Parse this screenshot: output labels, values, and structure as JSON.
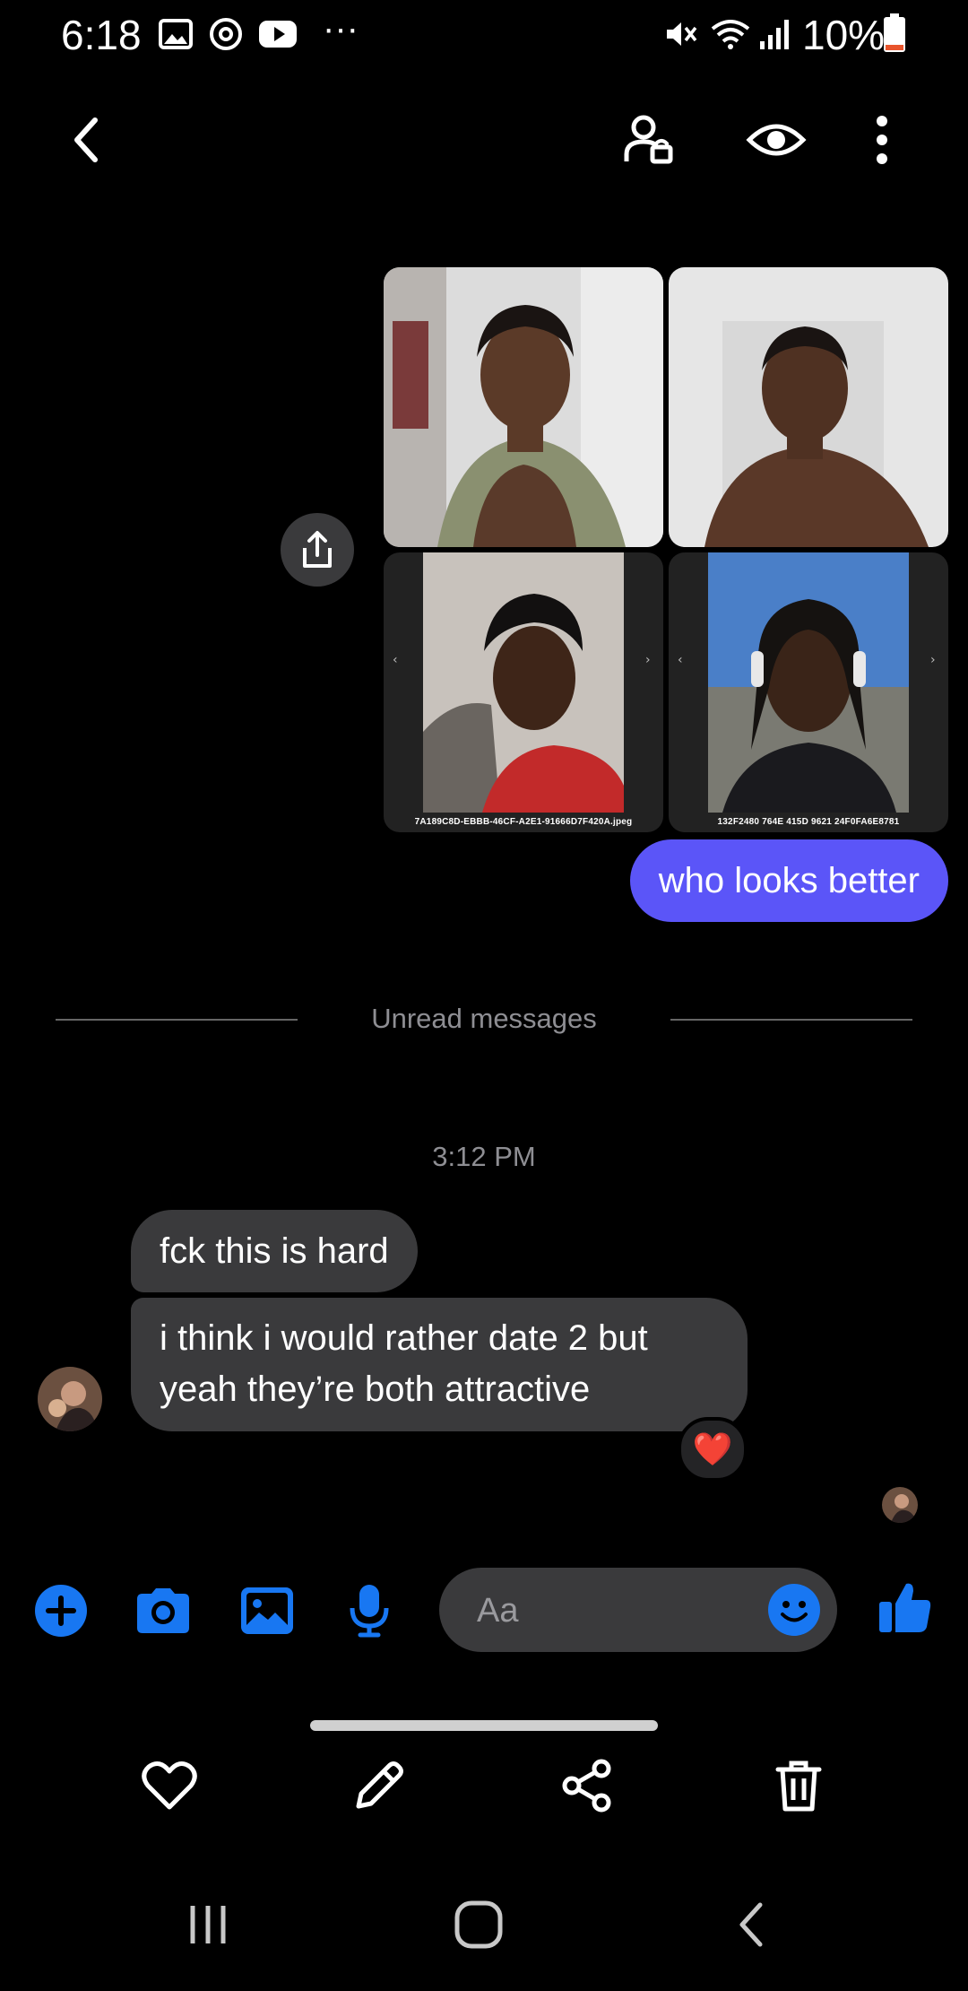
{
  "status_bar": {
    "time": "6:18",
    "battery": "10%",
    "more": "···",
    "icons": [
      "gallery-icon",
      "sync-icon",
      "youtube-icon",
      "mute-icon",
      "wifi-icon",
      "signal-icon",
      "battery-icon"
    ]
  },
  "header": {
    "icons": [
      "back-icon",
      "profile-icon",
      "eye-icon",
      "more-vertical-icon"
    ]
  },
  "photos": [
    {
      "caption": ""
    },
    {
      "caption": ""
    },
    {
      "caption": "7A189C8D-EBBB-46CF-A2E1-91666D7F420A.jpeg"
    },
    {
      "caption": "132F2480 764E 415D 9621 24F0FA6E8781"
    }
  ],
  "messages": {
    "outgoing_text": "who looks better",
    "unread_label": "Unread messages",
    "timestamp": "3:12 PM",
    "incoming_1": "fck this is hard",
    "incoming_2": "i think i would rather date 2 but yeah they’re both attractive",
    "reaction": "❤️"
  },
  "composer": {
    "placeholder": "Aa",
    "icons": [
      "plus-icon",
      "camera-icon",
      "gallery-icon",
      "microphone-icon",
      "emoji-icon",
      "thumbs-up-icon"
    ]
  },
  "actions": {
    "icons": [
      "heart-icon",
      "edit-icon",
      "share-icon",
      "trash-icon"
    ]
  },
  "nav": {
    "icons": [
      "recents-icon",
      "home-icon",
      "back-icon"
    ]
  },
  "colors": {
    "outgoing_bubble": "#5b55f8",
    "incoming_bubble": "#3a3a3c",
    "accent": "#1877f2"
  }
}
